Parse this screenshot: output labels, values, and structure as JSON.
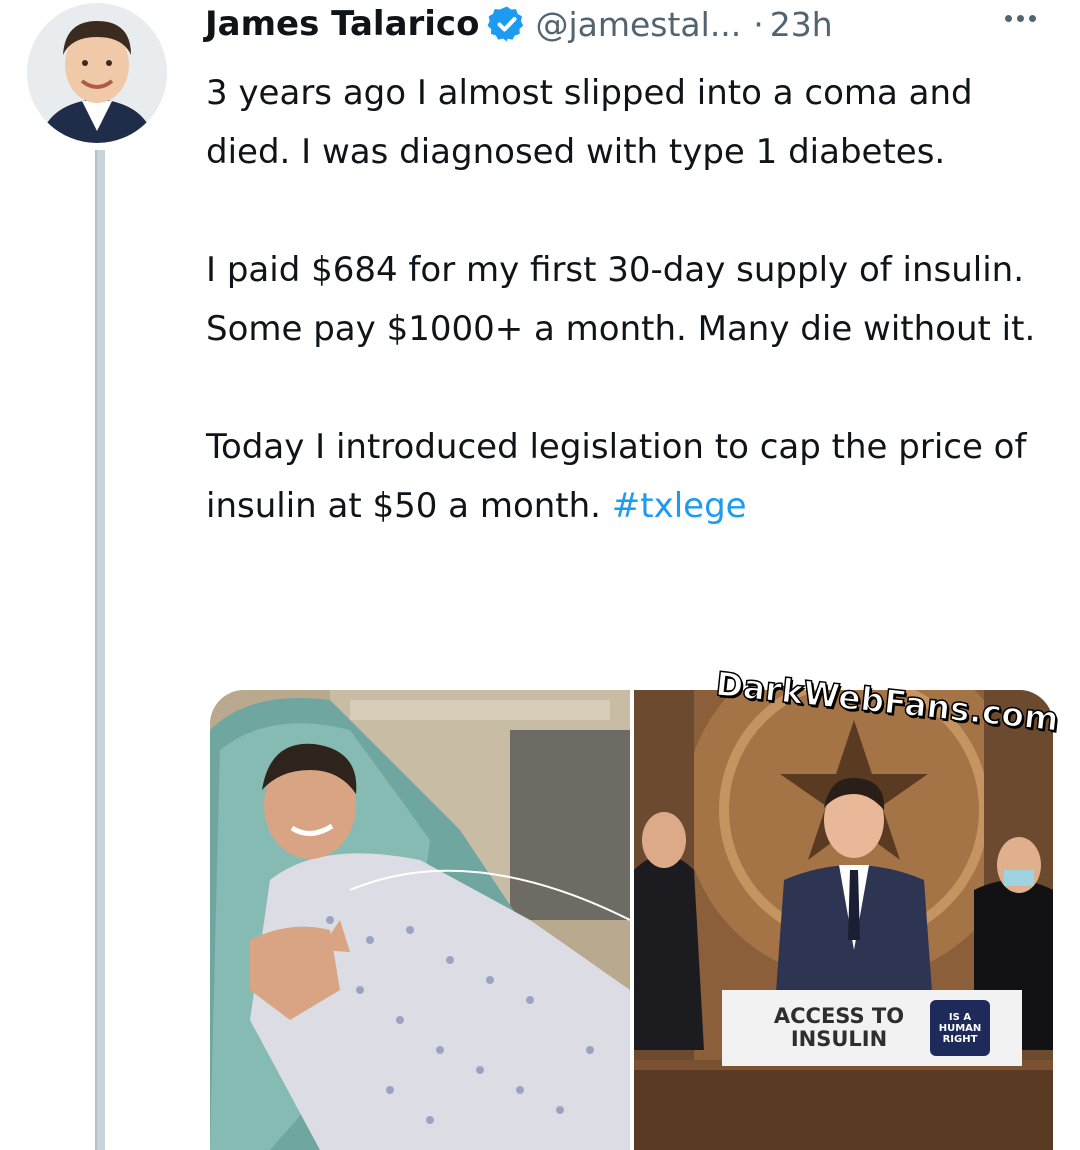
{
  "tweet": {
    "author_name": "James Talarico",
    "handle": "@jamestal...",
    "separator": "·",
    "time": "23h",
    "more_icon": "more-horizontal-icon",
    "verified_icon": "verified-badge-icon",
    "paragraphs": {
      "p1": "3 years ago I almost slipped into a coma and died. I was diagnosed with type 1 diabetes.",
      "p2": "I paid $684 for my first 30-day supply of insulin. Some pay $1000+ a month. Many die without it.",
      "p3": "Today I introduced legislation to cap the price of insulin at $50 a month.",
      "hashtag": "#txlege"
    }
  },
  "media": {
    "sign_text_line1": "ACCESS TO",
    "sign_text_line2": "INSULIN",
    "sign_badge_line1": "IS A",
    "sign_badge_line2": "HUMAN",
    "sign_badge_line3": "RIGHT"
  },
  "watermark": "DarkWebFans.com",
  "colors": {
    "link": "#1d9bf0",
    "verified": "#1d9bf0",
    "secondary_text": "#536471"
  }
}
